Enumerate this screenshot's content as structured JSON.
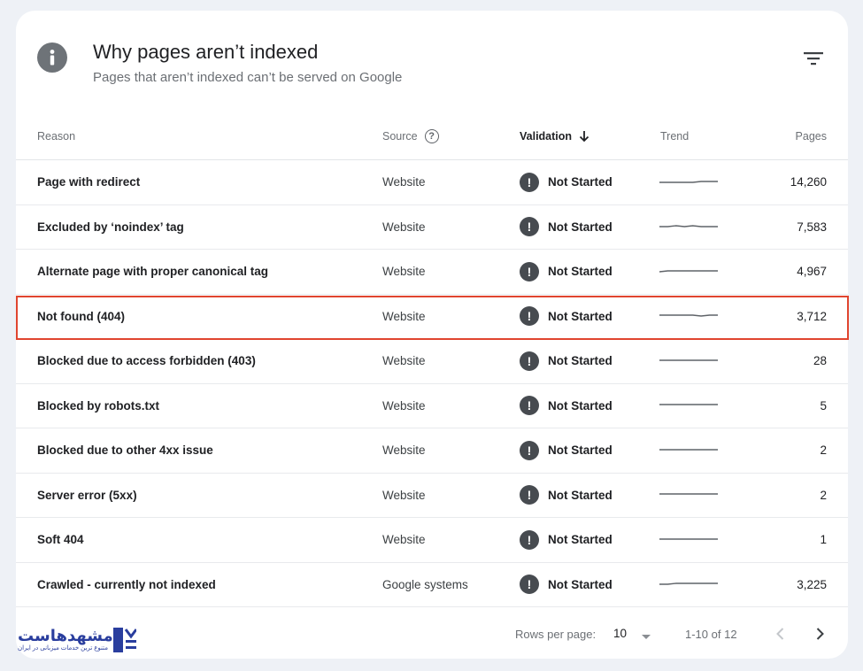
{
  "header": {
    "title": "Why pages aren’t indexed",
    "subtitle": "Pages that aren’t indexed can’t be served on Google",
    "info_icon": "info-icon",
    "filter_icon": "filter-icon"
  },
  "columns": {
    "reason": "Reason",
    "source": "Source",
    "validation": "Validation",
    "trend": "Trend",
    "pages": "Pages"
  },
  "rows": [
    {
      "reason": "Page with redirect",
      "source": "Website",
      "validation": "Not Started",
      "pages": "14,260",
      "trend": [
        5,
        5,
        5,
        5,
        5,
        4,
        4,
        4
      ]
    },
    {
      "reason": "Excluded by ‘noindex’ tag",
      "source": "Website",
      "validation": "Not Started",
      "pages": "7,583",
      "trend": [
        5,
        5,
        4,
        5,
        4,
        5,
        5,
        5
      ]
    },
    {
      "reason": "Alternate page with proper canonical tag",
      "source": "Website",
      "validation": "Not Started",
      "pages": "4,967",
      "trend": [
        5,
        4,
        4,
        4,
        4,
        4,
        4,
        4
      ]
    },
    {
      "reason": "Not found (404)",
      "source": "Website",
      "validation": "Not Started",
      "pages": "3,712",
      "trend": [
        4,
        4,
        4,
        4,
        4,
        5,
        4,
        4
      ]
    },
    {
      "reason": "Blocked due to access forbidden (403)",
      "source": "Website",
      "validation": "Not Started",
      "pages": "28",
      "trend": [
        4,
        4,
        4,
        4,
        4,
        4,
        4,
        4
      ]
    },
    {
      "reason": "Blocked by robots.txt",
      "source": "Website",
      "validation": "Not Started",
      "pages": "5",
      "trend": [
        4,
        4,
        4,
        4,
        4,
        4,
        4,
        4
      ]
    },
    {
      "reason": "Blocked due to other 4xx issue",
      "source": "Website",
      "validation": "Not Started",
      "pages": "2",
      "trend": [
        4,
        4,
        4,
        4,
        4,
        4,
        4,
        4
      ]
    },
    {
      "reason": "Server error (5xx)",
      "source": "Website",
      "validation": "Not Started",
      "pages": "2",
      "trend": [
        4,
        4,
        4,
        4,
        4,
        4,
        4,
        4
      ]
    },
    {
      "reason": "Soft 404",
      "source": "Website",
      "validation": "Not Started",
      "pages": "1",
      "trend": [
        4,
        4,
        4,
        4,
        4,
        4,
        4,
        4
      ]
    },
    {
      "reason": "Crawled - currently not indexed",
      "source": "Google systems",
      "validation": "Not Started",
      "pages": "3,225",
      "trend": [
        5,
        5,
        4,
        4,
        4,
        4,
        4,
        4
      ]
    }
  ],
  "pagination": {
    "rows_per_page_label": "Rows per page:",
    "rows_per_page": "10",
    "range": "1-10 of 12"
  },
  "logo": {
    "name": "مشهدهاست",
    "tagline": "متنوع ترین خدمات میزبانی در ایران"
  },
  "colors": {
    "highlight": "#e0452f",
    "warning_icon": "#474b50",
    "brand": "#2a3e9e"
  }
}
